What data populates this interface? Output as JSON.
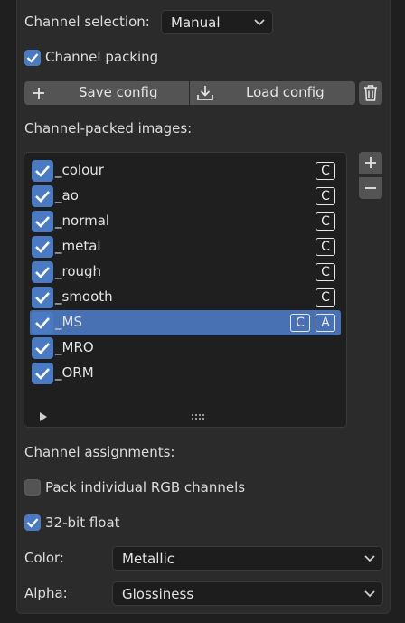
{
  "channel_selection": {
    "label": "Channel selection:",
    "value": "Manual"
  },
  "channel_packing": {
    "label": "Channel packing",
    "checked": true
  },
  "config": {
    "save_label": "Save config",
    "load_label": "Load config"
  },
  "images_heading": "Channel-packed images:",
  "images": [
    {
      "label": "_colour",
      "badges": [
        "C"
      ],
      "selected": false
    },
    {
      "label": "_ao",
      "badges": [
        "C"
      ],
      "selected": false
    },
    {
      "label": "_normal",
      "badges": [
        "C"
      ],
      "selected": false
    },
    {
      "label": "_metal",
      "badges": [
        "C"
      ],
      "selected": false
    },
    {
      "label": "_rough",
      "badges": [
        "C"
      ],
      "selected": false
    },
    {
      "label": "_smooth",
      "badges": [
        "C"
      ],
      "selected": false
    },
    {
      "label": "_MS",
      "badges": [
        "C",
        "A"
      ],
      "selected": true
    },
    {
      "label": "_MRO",
      "badges": [],
      "selected": false
    },
    {
      "label": "_ORM",
      "badges": [],
      "selected": false
    }
  ],
  "assignments_heading": "Channel assignments:",
  "pack_rgb": {
    "label": "Pack individual RGB channels",
    "checked": false
  },
  "float32": {
    "label": "32-bit float",
    "checked": true
  },
  "color": {
    "label": "Color:",
    "value": "Metallic"
  },
  "alpha": {
    "label": "Alpha:",
    "value": "Glossiness"
  },
  "colors": {
    "accent": "#4a7bc2",
    "selection": "#4771b2",
    "panel": "#2b2b2b",
    "field": "#1d1d1d"
  }
}
